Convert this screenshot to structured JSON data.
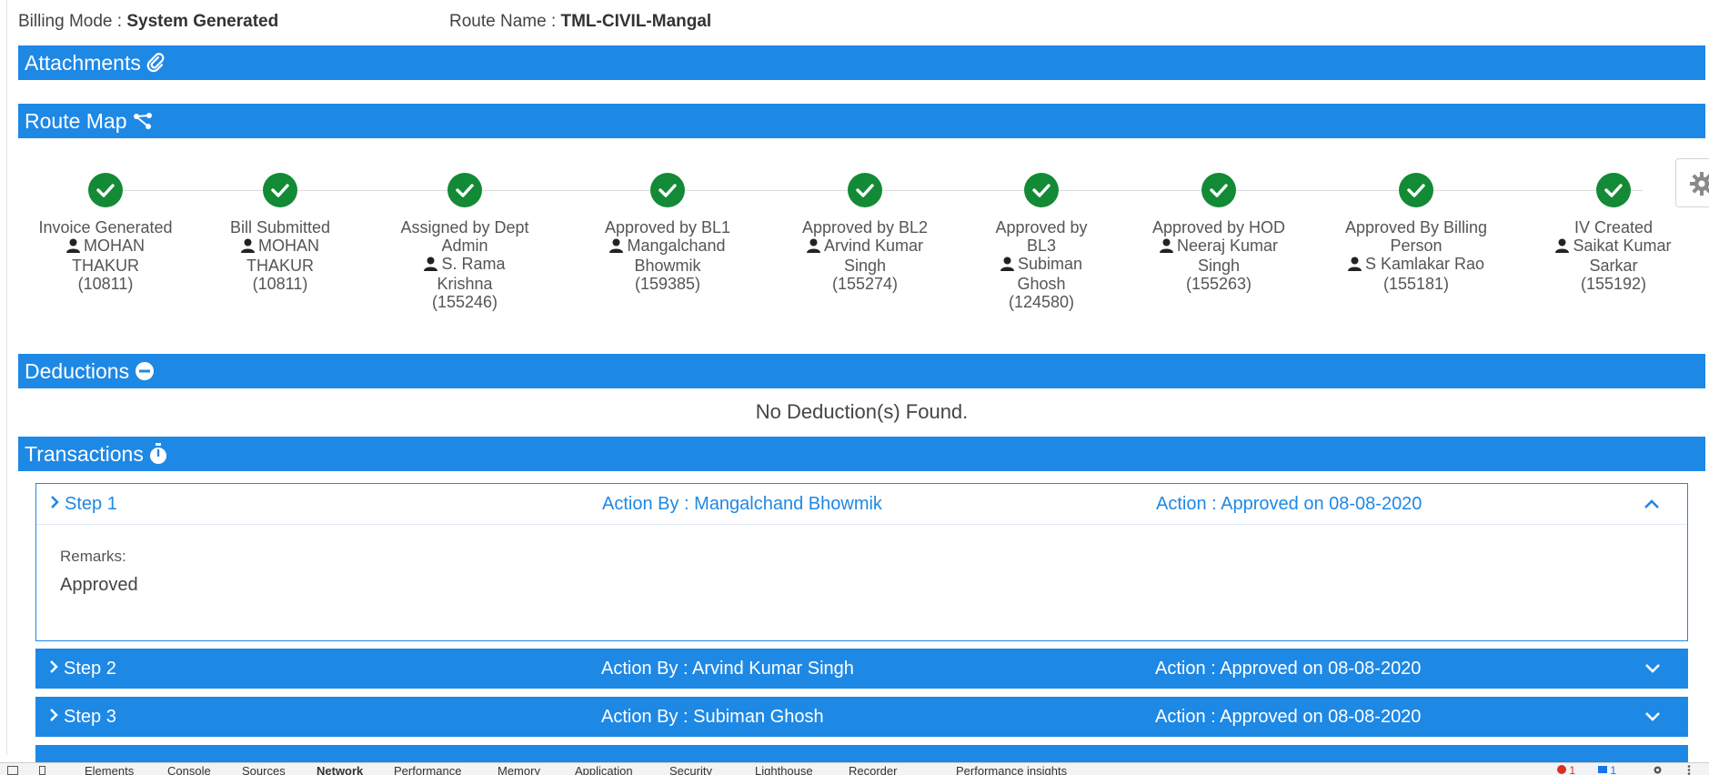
{
  "info": {
    "billing_mode_label": "Billing Mode : ",
    "billing_mode_value": "System Generated",
    "route_name_label": "Route Name : ",
    "route_name_value": "TML-CIVIL-Mangal"
  },
  "sections": {
    "attachments": "Attachments",
    "route_map": "Route Map",
    "deductions": "Deductions",
    "transactions": "Transactions"
  },
  "route_map": [
    {
      "title": "Invoice Generated",
      "person": "MOHAN THAKUR",
      "id": "(10811)"
    },
    {
      "title": "Bill Submitted",
      "person": "MOHAN THAKUR",
      "id": "(10811)"
    },
    {
      "title": "Assigned by Dept Admin",
      "person": "S. Rama Krishna",
      "id": "(155246)"
    },
    {
      "title": "Approved by BL1",
      "person": "Mangalchand Bhowmik",
      "id": "(159385)"
    },
    {
      "title": "Approved by BL2",
      "person": "Arvind Kumar Singh",
      "id": "(155274)"
    },
    {
      "title": "Approved by BL3",
      "person": "Subiman Ghosh",
      "id": "(124580)"
    },
    {
      "title": "Approved by HOD",
      "person": "Neeraj Kumar Singh",
      "id": "(155263)"
    },
    {
      "title": "Approved By Billing Person",
      "person": "S Kamlakar Rao",
      "id": "(155181)"
    },
    {
      "title": "IV Created",
      "person": "Saikat Kumar Sarkar",
      "id": "(155192)"
    }
  ],
  "deductions": {
    "empty_text": "No Deduction(s) Found."
  },
  "transactions": [
    {
      "step": "Step 1",
      "action_by": "Action By : Mangalchand Bhowmik",
      "action": "Action : Approved on 08-08-2020",
      "remarks_label": "Remarks:",
      "remarks": "Approved"
    },
    {
      "step": "Step 2",
      "action_by": "Action By : Arvind Kumar Singh",
      "action": "Action : Approved on 08-08-2020"
    },
    {
      "step": "Step 3",
      "action_by": "Action By : Subiman Ghosh",
      "action": "Action : Approved on 08-08-2020"
    }
  ],
  "devtools": {
    "tabs": [
      "Elements",
      "Console",
      "Sources",
      "Network",
      "Performance",
      "Memory",
      "Application",
      "Security",
      "Lighthouse",
      "Recorder",
      "Performance insights"
    ],
    "active_tab": "Network",
    "errors": "1",
    "messages": "1"
  },
  "colors": {
    "accent": "#1e88e5",
    "success": "#138a36"
  }
}
